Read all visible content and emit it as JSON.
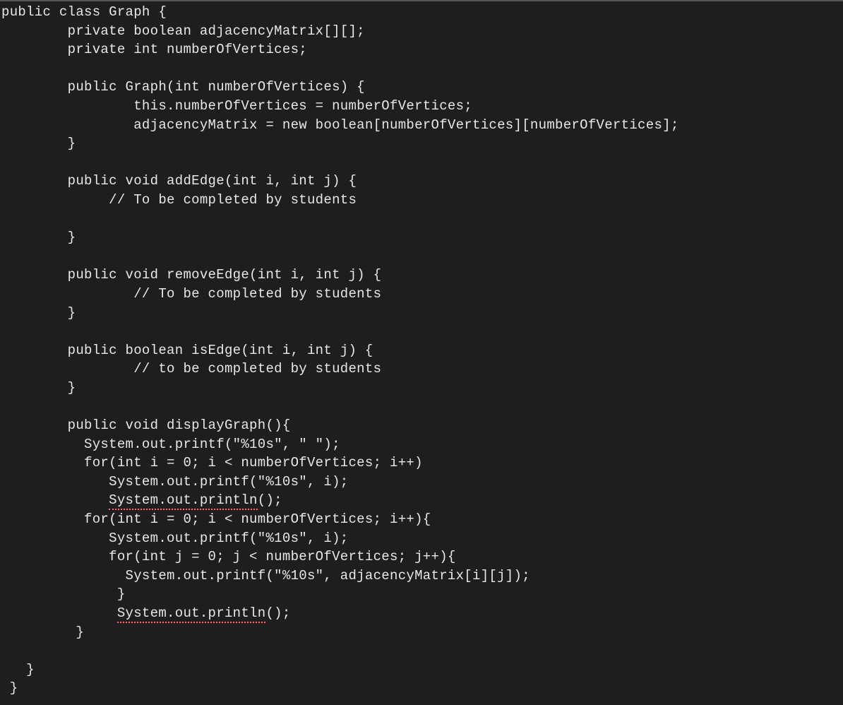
{
  "code": {
    "lines": [
      {
        "text": "public class Graph {",
        "indent": 0
      },
      {
        "text": "private boolean adjacencyMatrix[][];",
        "indent": 8
      },
      {
        "text": "private int numberOfVertices;",
        "indent": 8
      },
      {
        "text": "",
        "indent": 0
      },
      {
        "text": "public Graph(int numberOfVertices) {",
        "indent": 8
      },
      {
        "text": "this.numberOfVertices = numberOfVertices;",
        "indent": 16
      },
      {
        "text": "adjacencyMatrix = new boolean[numberOfVertices][numberOfVertices];",
        "indent": 16
      },
      {
        "text": "}",
        "indent": 8
      },
      {
        "text": "",
        "indent": 0
      },
      {
        "text": "public void addEdge(int i, int j) {",
        "indent": 8
      },
      {
        "text": "// To be completed by students",
        "indent": 13
      },
      {
        "text": "",
        "indent": 0
      },
      {
        "text": "}",
        "indent": 8
      },
      {
        "text": "",
        "indent": 0
      },
      {
        "text": "public void removeEdge(int i, int j) {",
        "indent": 8
      },
      {
        "text": "// To be completed by students",
        "indent": 16
      },
      {
        "text": "}",
        "indent": 8
      },
      {
        "text": "",
        "indent": 0
      },
      {
        "text": "public boolean isEdge(int i, int j) {",
        "indent": 8
      },
      {
        "text": "// to be completed by students",
        "indent": 16
      },
      {
        "text": "}",
        "indent": 8
      },
      {
        "text": "",
        "indent": 0
      },
      {
        "text": "public void displayGraph(){",
        "indent": 8
      },
      {
        "text": "System.out.printf(\"%10s\", \" \");",
        "indent": 10
      },
      {
        "text": "for(int i = 0; i < numberOfVertices; i++)",
        "indent": 10
      },
      {
        "text": "System.out.printf(\"%10s\", i);",
        "indent": 13
      },
      {
        "text": "System.out.println",
        "suffix": "();",
        "indent": 13,
        "underline": true
      },
      {
        "text": "for(int i = 0; i < numberOfVertices; i++){",
        "indent": 10
      },
      {
        "text": "System.out.printf(\"%10s\", i);",
        "indent": 13
      },
      {
        "text": "for(int j = 0; j < numberOfVertices; j++){",
        "indent": 13
      },
      {
        "text": "System.out.printf(\"%10s\", adjacencyMatrix[i][j]);",
        "indent": 15
      },
      {
        "text": "}",
        "indent": 14
      },
      {
        "text": "System.out.println",
        "suffix": "();",
        "indent": 14,
        "underline": true
      },
      {
        "text": "}",
        "indent": 9
      },
      {
        "text": "",
        "indent": 0
      },
      {
        "text": "}",
        "indent": 3
      },
      {
        "text": "}",
        "indent": 1
      }
    ]
  }
}
